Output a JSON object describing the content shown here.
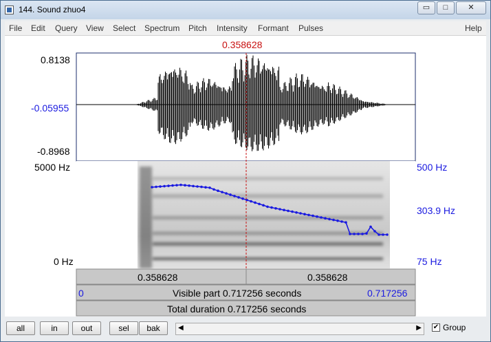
{
  "window": {
    "title": "144. Sound zhuo4",
    "minimize": "▭",
    "maximize": "□",
    "close": "✕"
  },
  "menu": [
    "File",
    "Edit",
    "Query",
    "View",
    "Select",
    "Spectrum",
    "Pitch",
    "Intensity",
    "Formant",
    "Pulses"
  ],
  "help_label": "Help",
  "cursor_time": "0.358628",
  "waveform": {
    "ymax": "0.8138",
    "ymid": "-0.05955",
    "ymin": "-0.8968"
  },
  "spectrogram": {
    "fmax": "5000 Hz",
    "fmin": "0 Hz",
    "pitch_max": "500 Hz",
    "pitch_mid": "303.9 Hz",
    "pitch_min": "75 Hz"
  },
  "bars": {
    "left_segment": "0.358628",
    "right_segment": "0.358628",
    "visible_start": "0",
    "visible_label": "Visible part 0.717256 seconds",
    "visible_end": "0.717256",
    "total_label": "Total duration 0.717256 seconds"
  },
  "buttons": {
    "all": "all",
    "in": "in",
    "out": "out",
    "sel": "sel",
    "bak": "bak"
  },
  "group": {
    "label": "Group",
    "checked": "✔"
  },
  "colors": {
    "pitch": "#1a1ae0",
    "cursor": "#c81010",
    "frame": "#1b2e6b"
  },
  "icons": [
    "app-icon",
    "minimize-icon",
    "maximize-icon",
    "close-icon",
    "scroll-left-icon",
    "scroll-right-icon"
  ]
}
